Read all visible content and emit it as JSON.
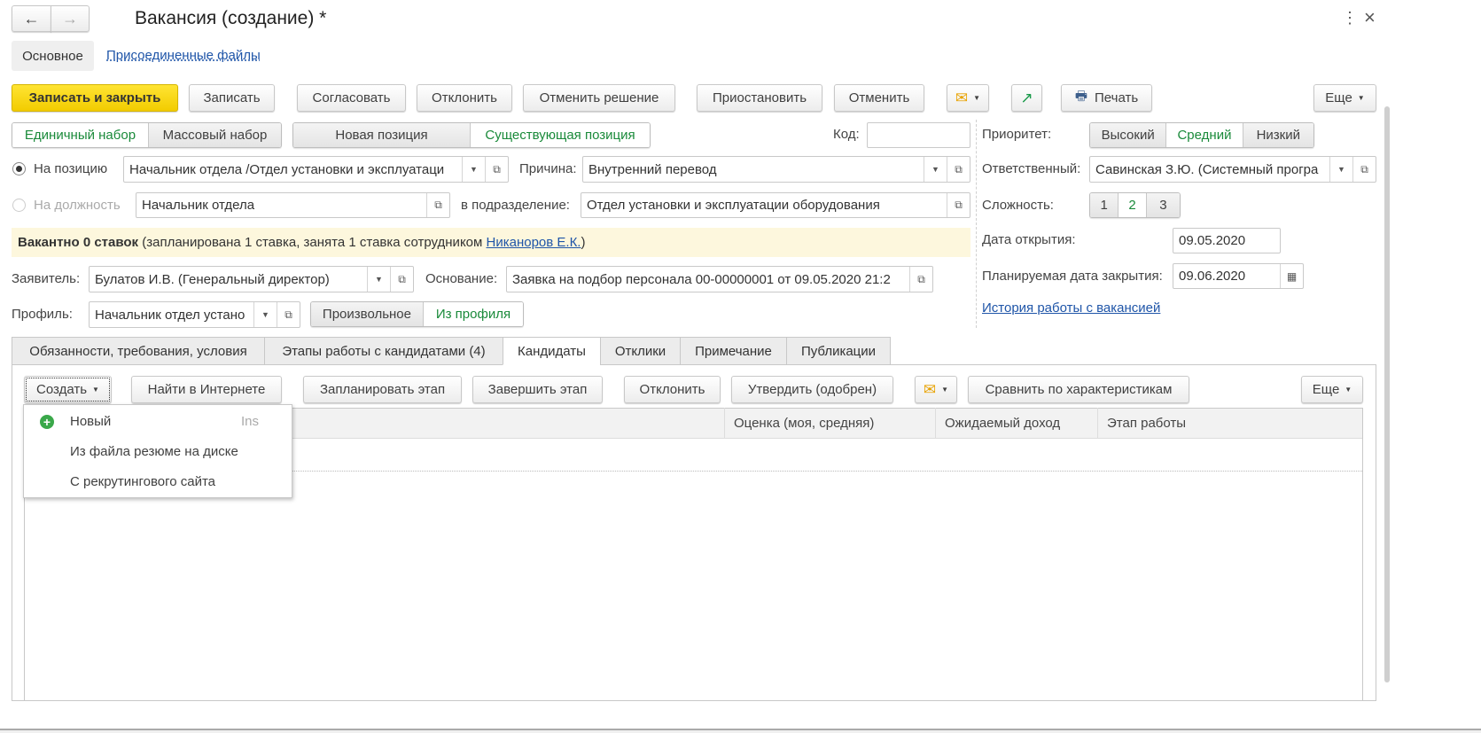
{
  "window": {
    "title": "Вакансия (создание) *",
    "back_icon": "arrow-left",
    "forward_icon": "arrow-right",
    "more_icon": "⋮",
    "close_icon": "×"
  },
  "nav": {
    "main": "Основное",
    "files": "Присоединенные файлы"
  },
  "toolbar": {
    "save_close": "Записать и закрыть",
    "save": "Записать",
    "approve": "Согласовать",
    "reject": "Отклонить",
    "cancel_decision": "Отменить решение",
    "suspend": "Приостановить",
    "cancel": "Отменить",
    "print": "Печать",
    "more": "Еще"
  },
  "recruit_type": {
    "options": [
      "Единичный набор",
      "Массовый набор"
    ],
    "selected": 0
  },
  "position_type": {
    "options": [
      "Новая позиция",
      "Существующая позиция"
    ],
    "selected": 1
  },
  "code": {
    "label": "Код:",
    "value": ""
  },
  "priority": {
    "label": "Приоритет:",
    "options": [
      "Высокий",
      "Средний",
      "Низкий"
    ],
    "selected": 1
  },
  "responsible": {
    "label": "Ответственный:",
    "value": "Савинская З.Ю. (Системный програ"
  },
  "complexity": {
    "label": "Сложность:",
    "options": [
      "1",
      "2",
      "3"
    ],
    "selected": 1
  },
  "open_date": {
    "label": "Дата открытия:",
    "value": "09.05.2020"
  },
  "close_date": {
    "label": "Планируемая дата закрытия:",
    "value": "09.06.2020"
  },
  "history_link": "История работы с вакансией",
  "on_position": {
    "label": "На позицию",
    "value": "Начальник отдела /Отдел установки и эксплуатаци"
  },
  "reason": {
    "label": "Причина:",
    "value": "Внутренний перевод"
  },
  "on_job": {
    "label": "На должность",
    "value": "Начальник отдела"
  },
  "department": {
    "label": "в подразделение:",
    "value": "Отдел установки и эксплуатации оборудования"
  },
  "vacancy_info": {
    "bold": "Вакантно 0 ставок",
    "text": " (запланирована 1 ставка, занята 1 ставка сотрудником ",
    "employee": "Никаноров Е.К.",
    "tail": ")"
  },
  "applicant": {
    "label": "Заявитель:",
    "value": "Булатов И.В. (Генеральный директор)"
  },
  "basis": {
    "label": "Основание:",
    "value": "Заявка на подбор персонала 00-00000001 от 09.05.2020 21:2"
  },
  "profile": {
    "label": "Профиль:",
    "value": "Начальник отдел устано",
    "options": [
      "Произвольное",
      "Из профиля"
    ],
    "selected": 1
  },
  "tabs": [
    "Обязанности, требования, условия",
    "Этапы работы с кандидатами (4)",
    "Кандидаты",
    "Отклики",
    "Примечание",
    "Публикации"
  ],
  "active_tab": 2,
  "cand_toolbar": {
    "create": "Создать",
    "find": "Найти в Интернете",
    "plan": "Запланировать этап",
    "finish": "Завершить этап",
    "reject": "Отклонить",
    "approve": "Утвердить (одобрен)",
    "compare": "Сравнить по характеристикам",
    "more": "Еще"
  },
  "table": {
    "columns": [
      "",
      "Оценка (моя, средняя)",
      "Ожидаемый доход",
      "Этап работы"
    ]
  },
  "create_menu": [
    {
      "label": "Новый",
      "shortcut": "Ins"
    },
    {
      "label": "Из файла резюме на диске"
    },
    {
      "label": "С рекрутингового сайта"
    }
  ]
}
